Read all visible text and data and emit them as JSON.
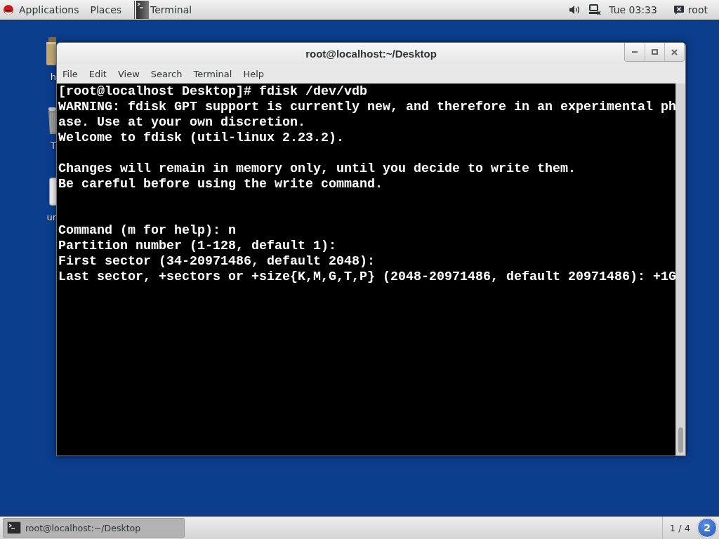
{
  "top_bar": {
    "menus": [
      "Applications",
      "Places"
    ],
    "active_app": "Terminal",
    "clock": "Tue 03:33",
    "user": "root"
  },
  "desktop_icons": [
    {
      "kind": "folder",
      "label": "h"
    },
    {
      "kind": "trash",
      "label": "T"
    },
    {
      "kind": "drive",
      "label": "ur"
    }
  ],
  "window": {
    "title": "root@localhost:~/Desktop",
    "menu": [
      "File",
      "Edit",
      "View",
      "Search",
      "Terminal",
      "Help"
    ],
    "terminal": {
      "lines": [
        {
          "kind": "text",
          "text": "[root@localhost Desktop]# fdisk /dev/vdb"
        },
        {
          "kind": "text",
          "text": "WARNING: fdisk GPT support is currently new, and therefore in an experimental ph"
        },
        {
          "kind": "text",
          "text": "ase. Use at your own discretion."
        },
        {
          "kind": "text",
          "text": "Welcome to fdisk (util-linux 2.23.2)."
        },
        {
          "kind": "blank"
        },
        {
          "kind": "text",
          "text": "Changes will remain in memory only, until you decide to write them."
        },
        {
          "kind": "text",
          "text": "Be careful before using the write command."
        },
        {
          "kind": "blank"
        },
        {
          "kind": "blank"
        },
        {
          "kind": "text",
          "text": "Command (m for help): n"
        },
        {
          "kind": "text",
          "text": "Partition number (1-128, default 1):"
        },
        {
          "kind": "text",
          "text": "First sector (34-20971486, default 2048):"
        },
        {
          "kind": "text",
          "text": "Last sector, +sectors or +size{K,M,G,T,P} (2048-20971486, default 20971486): +1G"
        }
      ]
    }
  },
  "taskbar": {
    "tasks": [
      {
        "label": "root@localhost:~/Desktop",
        "selected": true
      }
    ],
    "workspace": "1 / 4",
    "notifications": "2"
  }
}
